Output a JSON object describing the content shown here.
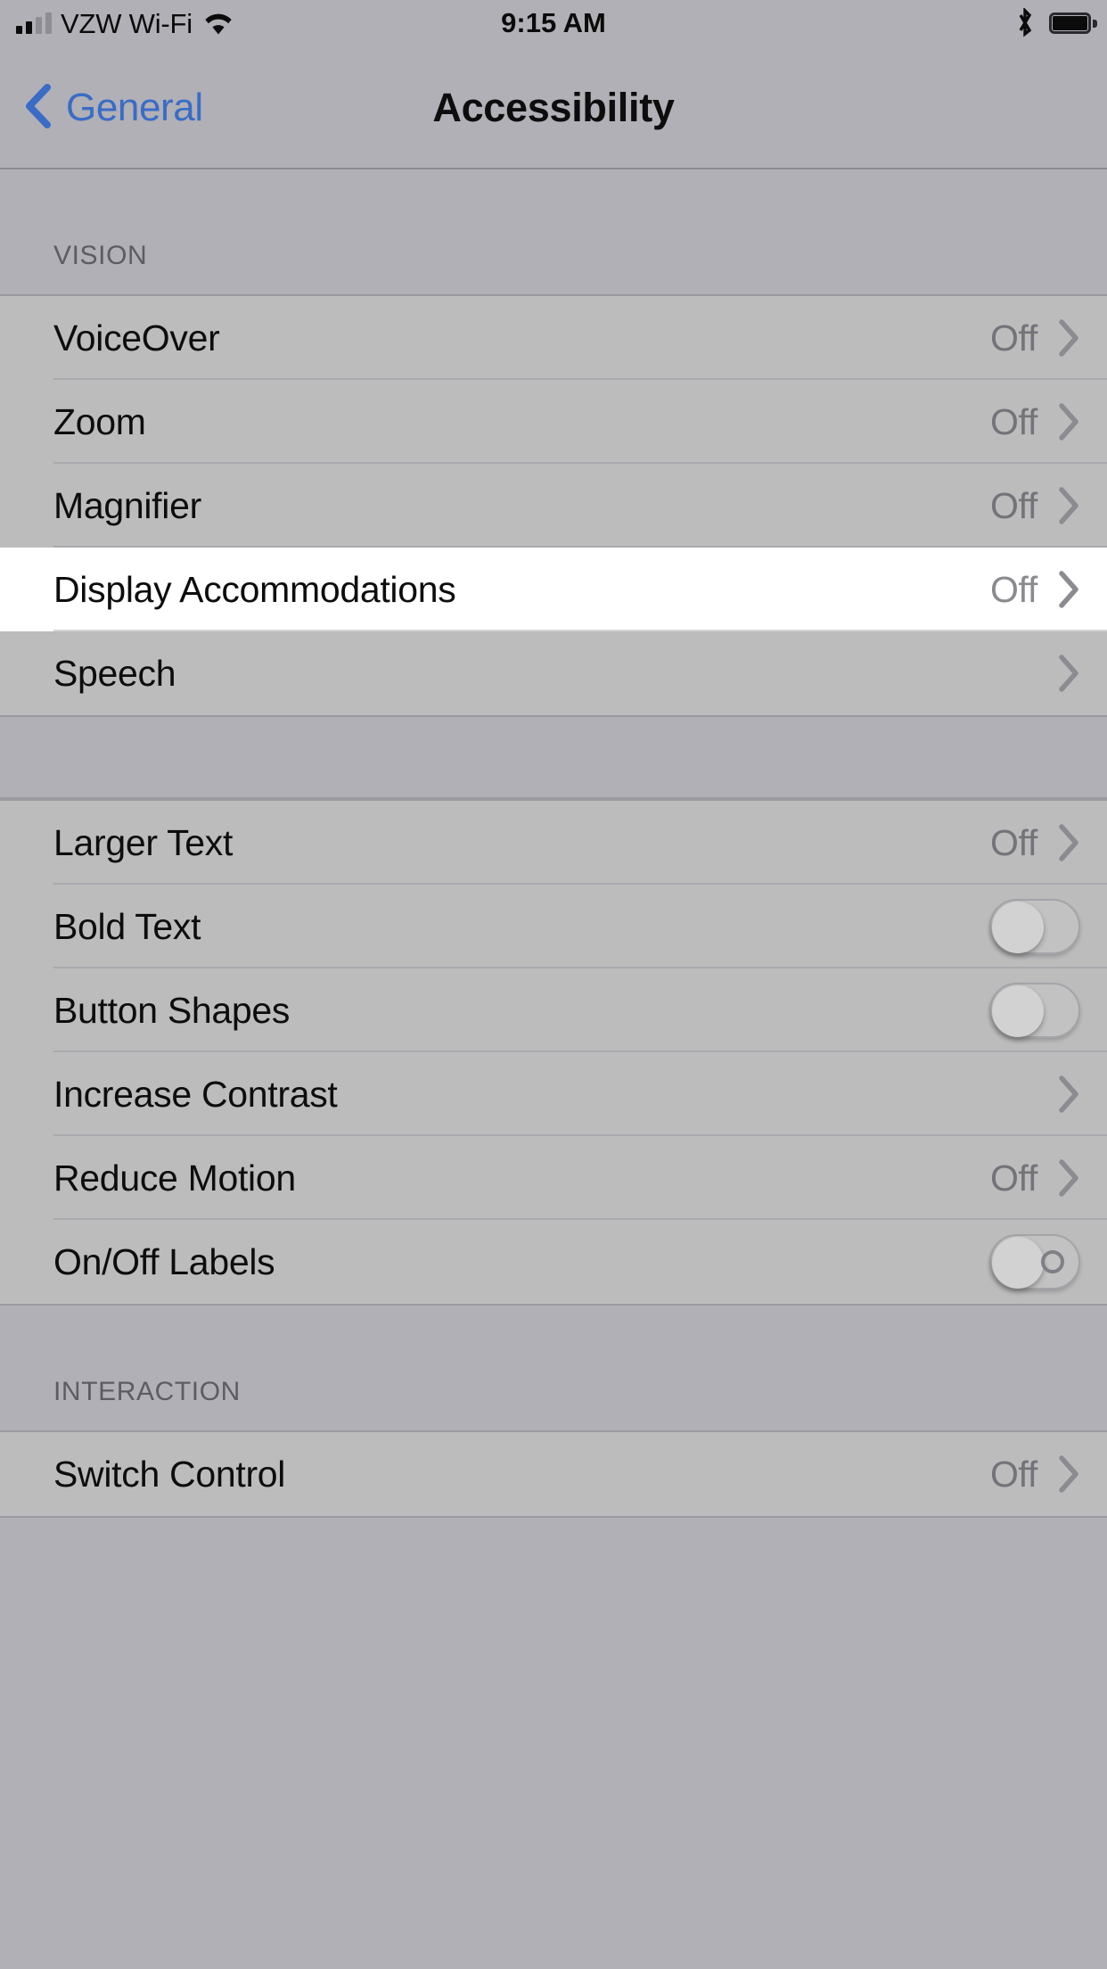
{
  "status_bar": {
    "signal_icon": "cell-signal-bars",
    "signal_bars_filled": 2,
    "signal_bars_total": 4,
    "carrier": "VZW Wi-Fi",
    "wifi_icon": "wifi-icon",
    "time": "9:15 AM",
    "bluetooth_icon": "bluetooth-icon",
    "battery_icon": "battery-full-icon"
  },
  "nav": {
    "back_icon": "chevron-left-icon",
    "back_label": "General",
    "title": "Accessibility",
    "back_color": "#3a6cc6"
  },
  "sections": [
    {
      "header": "VISION",
      "rows": [
        {
          "label": "VoiceOver",
          "value": "Off",
          "accessory": "chevron",
          "highlighted": false
        },
        {
          "label": "Zoom",
          "value": "Off",
          "accessory": "chevron",
          "highlighted": false
        },
        {
          "label": "Magnifier",
          "value": "Off",
          "accessory": "chevron",
          "highlighted": false
        },
        {
          "label": "Display Accommodations",
          "value": "Off",
          "accessory": "chevron",
          "highlighted": true
        },
        {
          "label": "Speech",
          "value": "",
          "accessory": "chevron",
          "highlighted": false
        }
      ]
    },
    {
      "header": "",
      "rows": [
        {
          "label": "Larger Text",
          "value": "Off",
          "accessory": "chevron",
          "highlighted": false
        },
        {
          "label": "Bold Text",
          "value": "",
          "accessory": "toggle",
          "toggle_on": false,
          "toggle_labels": false,
          "highlighted": false
        },
        {
          "label": "Button Shapes",
          "value": "",
          "accessory": "toggle",
          "toggle_on": false,
          "toggle_labels": false,
          "highlighted": false
        },
        {
          "label": "Increase Contrast",
          "value": "",
          "accessory": "chevron",
          "highlighted": false
        },
        {
          "label": "Reduce Motion",
          "value": "Off",
          "accessory": "chevron",
          "highlighted": false
        },
        {
          "label": "On/Off Labels",
          "value": "",
          "accessory": "toggle",
          "toggle_on": false,
          "toggle_labels": true,
          "highlighted": false
        }
      ]
    },
    {
      "header": "INTERACTION",
      "rows": [
        {
          "label": "Switch Control",
          "value": "Off",
          "accessory": "chevron",
          "highlighted": false
        }
      ]
    }
  ],
  "colors": {
    "page_background": "#b0b0b6",
    "cell_background": "#bcbcbd",
    "cell_highlight": "#ffffff",
    "separator": "#a9a9ae",
    "primary_text": "#0d0d0d",
    "secondary_text": "#73737a",
    "tint": "#3a6cc6"
  }
}
